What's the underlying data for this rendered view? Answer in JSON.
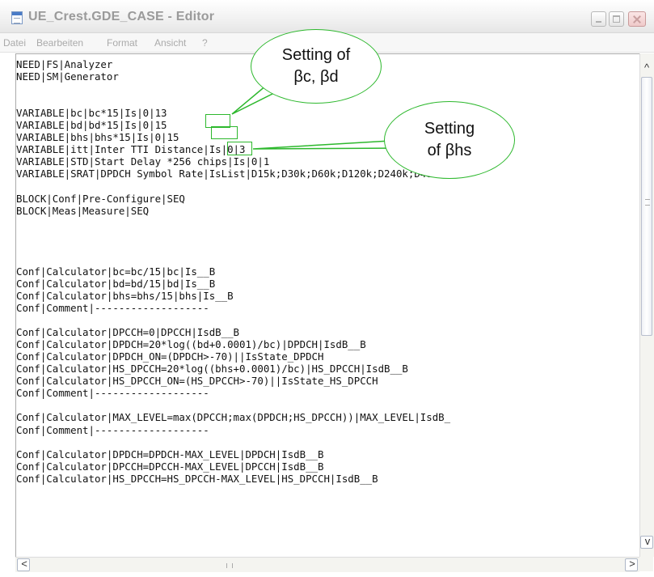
{
  "window": {
    "title": "UE_Crest.GDE_CASE - Editor"
  },
  "menu": [
    "Datei",
    "Bearbeiten",
    "Format",
    "Ansicht",
    "?"
  ],
  "lines": [
    "NEED|FS|Analyzer",
    "NEED|SM|Generator",
    "",
    "",
    "VARIABLE|bc|bc*15|Is|0|13",
    "VARIABLE|bd|bd*15|Is|0|15",
    "VARIABLE|bhs|bhs*15|Is|0|15",
    "VARIABLE|itt|Inter TTI Distance|Is|0|3",
    "VARIABLE|STD|Start Delay *256 chips|Is|0|1",
    "VARIABLE|SRAT|DPDCH Symbol Rate|IsList|D15k;D30k;D60k;D120k;D240k;D480k;D",
    "",
    "BLOCK|Conf|Pre-Configure|SEQ",
    "BLOCK|Meas|Measure|SEQ",
    "",
    "",
    "",
    "",
    "Conf|Calculator|bc=bc/15|bc|Is__B",
    "Conf|Calculator|bd=bd/15|bd|Is__B",
    "Conf|Calculator|bhs=bhs/15|bhs|Is__B",
    "Conf|Comment|-------------------",
    "",
    "Conf|Calculator|DPCCH=0|DPCCH|IsdB__B",
    "Conf|Calculator|DPDCH=20*log((bd+0.0001)/bc)|DPDCH|IsdB__B",
    "Conf|Calculator|DPDCH_ON=(DPDCH>-70)||IsState_DPDCH",
    "Conf|Calculator|HS_DPCCH=20*log((bhs+0.0001)/bc)|HS_DPCCH|IsdB__B",
    "Conf|Calculator|HS_DPCCH_ON=(HS_DPCCH>-70)||IsState_HS_DPCCH",
    "Conf|Comment|-------------------",
    "",
    "Conf|Calculator|MAX_LEVEL=max(DPCCH;max(DPDCH;HS_DPCCH))|MAX_LEVEL|IsdB_",
    "Conf|Comment|-------------------",
    "",
    "Conf|Calculator|DPDCH=DPDCH-MAX_LEVEL|DPDCH|IsdB__B",
    "Conf|Calculator|DPCCH=DPCCH-MAX_LEVEL|DPCCH|IsdB__B",
    "Conf|Calculator|HS_DPCCH=HS_DPCCH-MAX_LEVEL|HS_DPCCH|IsdB__B"
  ],
  "callouts": {
    "bc_bd": {
      "line1": "Setting of",
      "line2": "βc, βd"
    },
    "bhs": {
      "line1": "Setting",
      "line2": "of βhs"
    }
  },
  "scrollbar_glyphs": {
    "up": "^",
    "down": "v",
    "left": "<",
    "right": ">"
  },
  "colors": {
    "highlight": "#2db82d",
    "title_text": "#9a9a9a",
    "menu_text": "#aaaaaa"
  }
}
